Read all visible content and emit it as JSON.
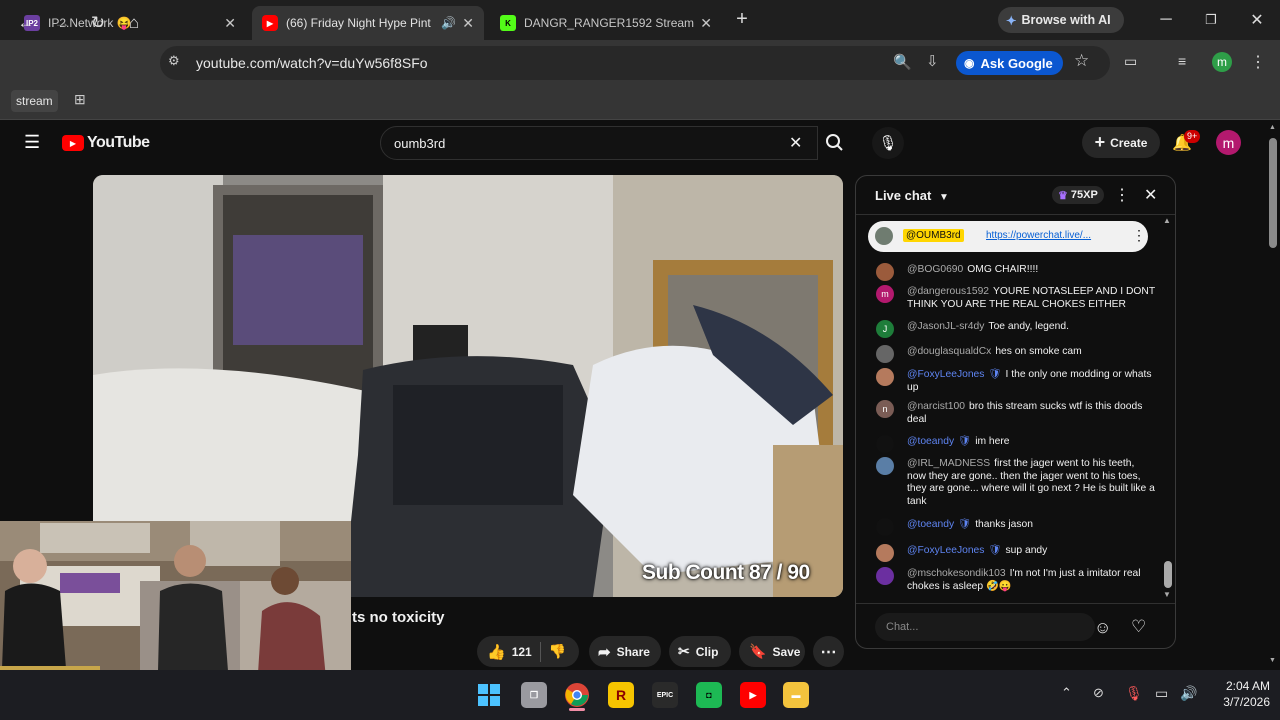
{
  "tabs": [
    {
      "title": "IP2.Network 😝",
      "active": false
    },
    {
      "title": "(66) Friday Night Hype Pint",
      "active": true
    },
    {
      "title": "DANGR_RANGER1592 Stream -",
      "active": false
    }
  ],
  "browser": {
    "browse_ai": "Browse with AI",
    "url": "youtube.com/watch?v=duYw56f8SFo",
    "ask_google": "Ask Google",
    "profile_initial": "m",
    "bookmark": "stream"
  },
  "youtube": {
    "logo": "YouTube",
    "search_value": "oumb3rd",
    "create": "Create",
    "notif_badge": "9+",
    "avatar_initial": "m",
    "title_fragment": "ts no toxicity",
    "likes": "121",
    "share": "Share",
    "clip": "Clip",
    "save": "Save",
    "overlay": "Sub Count  87 / 90"
  },
  "chat": {
    "header": "Live chat",
    "xp": "75XP",
    "pinned_author": "@OUMB3rd",
    "pinned_link": "https://powerchat.live/...",
    "placeholder": "Chat...",
    "messages": [
      {
        "author": "@BOG0690",
        "text": "OMG CHAIR!!!!",
        "mod": false,
        "avatar_color": "#9b5b3c",
        "initial": ""
      },
      {
        "author": "@dangerous1592",
        "text": "YOURE NOTASLEEP AND I DONT THINK YOU ARE THE REAL CHOKES EITHER",
        "mod": false,
        "avatar_color": "#b3196e",
        "initial": "m"
      },
      {
        "author": "@JasonJL-sr4dy",
        "text": "Toe andy, legend.",
        "mod": false,
        "avatar_color": "#1e7d3a",
        "initial": "J"
      },
      {
        "author": "@douglasqualdCx",
        "text": "hes on smoke cam",
        "mod": false,
        "avatar_color": "#666",
        "initial": ""
      },
      {
        "author": "@FoxyLeeJones",
        "text": "I the only one modding or whats up",
        "mod": true,
        "avatar_color": "#b57a5d",
        "initial": ""
      },
      {
        "author": "@narcist100",
        "text": "bro this stream sucks wtf is this doods deal",
        "mod": false,
        "avatar_color": "#7a5c55",
        "initial": "n"
      },
      {
        "author": "@toeandy",
        "text": "im here",
        "mod": true,
        "avatar_color": "#111",
        "initial": ""
      },
      {
        "author": "@IRL_MADNESS",
        "text": "first the jager went to his teeth, now they are gone.. then the jager went to his toes, they are gone... where will it go next ? He is built like a tank",
        "mod": false,
        "avatar_color": "#5a7ea6",
        "initial": ""
      },
      {
        "author": "@toeandy",
        "text": "thanks jason",
        "mod": true,
        "avatar_color": "#111",
        "initial": ""
      },
      {
        "author": "@FoxyLeeJones",
        "text": "sup andy",
        "mod": true,
        "avatar_color": "#b57a5d",
        "initial": ""
      },
      {
        "author": "@mschokesondik103",
        "text": "I'm not I'm just a imitator real chokes is asleep 🤣😛",
        "mod": false,
        "avatar_color": "#6b2fa0",
        "initial": ""
      }
    ]
  },
  "taskbar": {
    "time": "2:04 AM",
    "date": "3/7/2026"
  }
}
